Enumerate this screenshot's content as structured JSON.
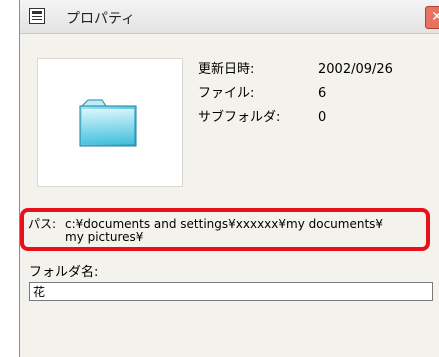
{
  "window": {
    "title": "プロパティ",
    "close_label": "✕"
  },
  "thumbnail": {
    "icon": "folder-icon"
  },
  "info": {
    "updated_label": "更新日時:",
    "updated_value": "2002/09/26",
    "files_label": "ファイル:",
    "files_value": "6",
    "subfolders_label": "サブフォルダ:",
    "subfolders_value": "0"
  },
  "path": {
    "label": "パス:",
    "value": "c:¥documents and settings¥xxxxxx¥my documents¥\nmy pictures¥"
  },
  "folder_name": {
    "label": "フォルダ名:",
    "value": "花"
  },
  "colors": {
    "highlight": "#e8111b",
    "window_bg": "#f3f2ec"
  }
}
